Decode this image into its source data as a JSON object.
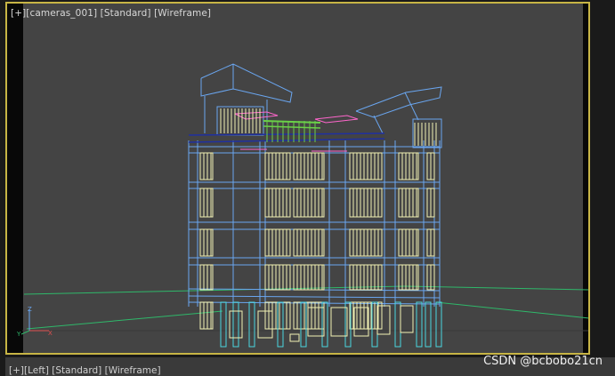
{
  "viewport_top": {
    "label_parts": [
      "[+]",
      "[cameras_001]",
      "[Standard]",
      "[Wireframe]"
    ],
    "border_color": "#c8b545"
  },
  "viewport_bottom": {
    "label_parts": [
      "[+]",
      "[Left]",
      "[Standard]",
      "[Wireframe]"
    ]
  },
  "gizmo": {
    "axes": [
      "Z",
      "Y",
      "X"
    ]
  },
  "scene_colors": {
    "background": "#444444",
    "building_wire": "#6aa6f0",
    "windows": "#f2f2b4",
    "railings": "#6ad048",
    "planters": "#ff66cc",
    "columns": "#4ad6e0",
    "ground_lines": "#2fb86a",
    "beams": "#2030a0"
  },
  "watermark": "CSDN @bcbobo21cn"
}
